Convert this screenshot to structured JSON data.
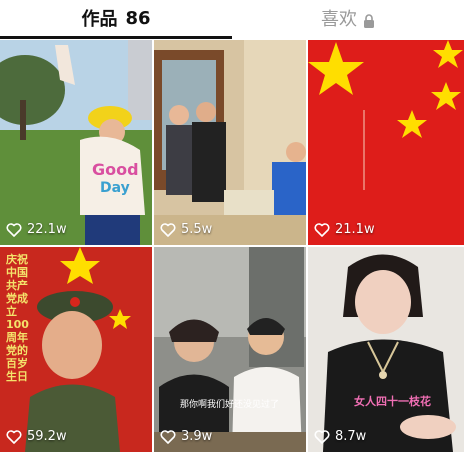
{
  "tabs": {
    "works_label": "作品",
    "works_count": "86",
    "likes_label": "喜欢"
  },
  "videos": [
    {
      "likes": "22.1w"
    },
    {
      "likes": "5.5w"
    },
    {
      "likes": "21.1w"
    },
    {
      "likes": "59.2w",
      "caption": "庆祝中国共产党成立100周年 党的百岁生日"
    },
    {
      "likes": "3.9w",
      "subtitle": "那你啊我们好还没见过了"
    },
    {
      "likes": "8.7w",
      "caption": "女人四十一枝花"
    }
  ],
  "colors": {
    "accent": "#111111",
    "muted": "#9a9a9a",
    "flag_red": "#e0201c",
    "star_yellow": "#ffde00"
  },
  "icons": {
    "like": "heart-outline-icon",
    "lock": "lock-icon"
  }
}
